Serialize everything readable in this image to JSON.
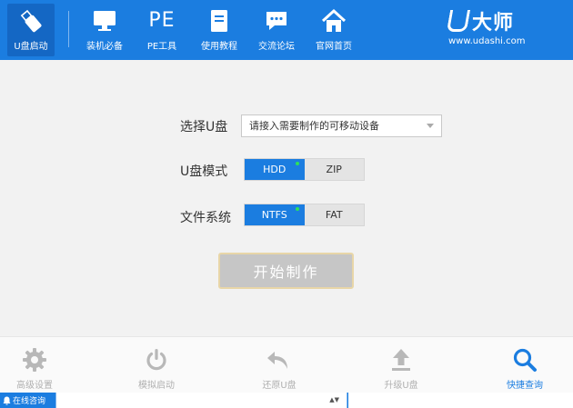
{
  "nav": {
    "items": [
      {
        "label": "U盘启动",
        "icon": "usb-drive-icon",
        "active": true
      },
      {
        "label": "装机必备",
        "icon": "monitor-icon"
      },
      {
        "label": "PE工具",
        "icon": "pe-text-icon",
        "glyph": "PE"
      },
      {
        "label": "使用教程",
        "icon": "book-icon"
      },
      {
        "label": "交流论坛",
        "icon": "chat-bubble-icon"
      },
      {
        "label": "官网首页",
        "icon": "home-icon"
      }
    ]
  },
  "brand": {
    "name": "大师",
    "url": "www.udashi.com"
  },
  "form": {
    "select_label": "选择U盘",
    "select_value": "请接入需要制作的可移动设备",
    "mode_label": "U盘模式",
    "mode_options": [
      "HDD",
      "ZIP"
    ],
    "mode_selected": "HDD",
    "fs_label": "文件系统",
    "fs_options": [
      "NTFS",
      "FAT"
    ],
    "fs_selected": "NTFS",
    "start_label": "开始制作"
  },
  "toolbar": {
    "items": [
      {
        "label": "高级设置",
        "icon": "gear-icon"
      },
      {
        "label": "模拟启动",
        "icon": "power-icon"
      },
      {
        "label": "还原U盘",
        "icon": "undo-icon"
      },
      {
        "label": "升级U盘",
        "icon": "upload-icon"
      },
      {
        "label": "快捷查询",
        "icon": "search-icon",
        "active": true
      }
    ]
  },
  "status": {
    "consult_label": "在线咨询",
    "spin_glyph": "▲▼"
  },
  "colors": {
    "primary": "#1b7de0",
    "active_nav": "#1467c4",
    "indicator": "#2ee05a"
  }
}
